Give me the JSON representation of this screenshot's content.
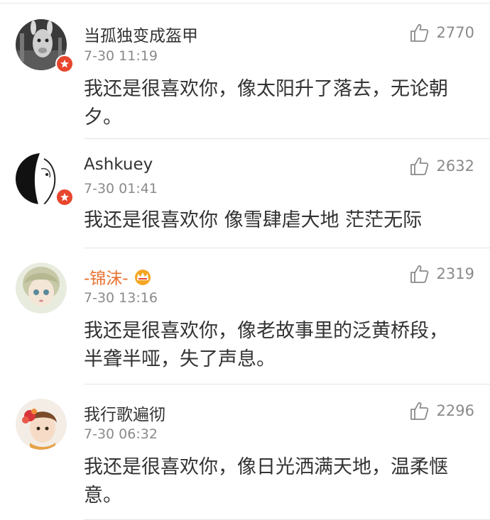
{
  "comments": [
    {
      "username": "当孤独变成盔甲",
      "time": "7-30 11:19",
      "likes": "2770",
      "text": "我还是很喜欢你，像太阳升了落去，无论朝夕。",
      "avatar_icon": "avatar-alpaca",
      "verified": true,
      "vip": false
    },
    {
      "username": "Ashkuey",
      "time": "7-30 01:41",
      "likes": "2632",
      "text": "我还是很喜欢你 像雪肆虐大地 茫茫无际",
      "avatar_icon": "avatar-bw-figure",
      "verified": true,
      "vip": false
    },
    {
      "username": "-锦沫-",
      "time": "7-30 13:16",
      "likes": "2319",
      "text": "我还是很喜欢你，像老故事里的泛黄桥段，半聋半哑，失了声息。",
      "avatar_icon": "avatar-anime-girl",
      "verified": false,
      "vip": true
    },
    {
      "username": "我行歌遍彻",
      "time": "7-30 06:32",
      "likes": "2296",
      "text": "我还是很喜欢你，像日光洒满天地，温柔惬意。",
      "avatar_icon": "avatar-flower-girl",
      "verified": false,
      "vip": false
    }
  ],
  "colors": {
    "vip_name": "#e8712f",
    "badge": "#e8462e",
    "meta_gray": "#8a8a8a",
    "body_text": "#333333"
  }
}
